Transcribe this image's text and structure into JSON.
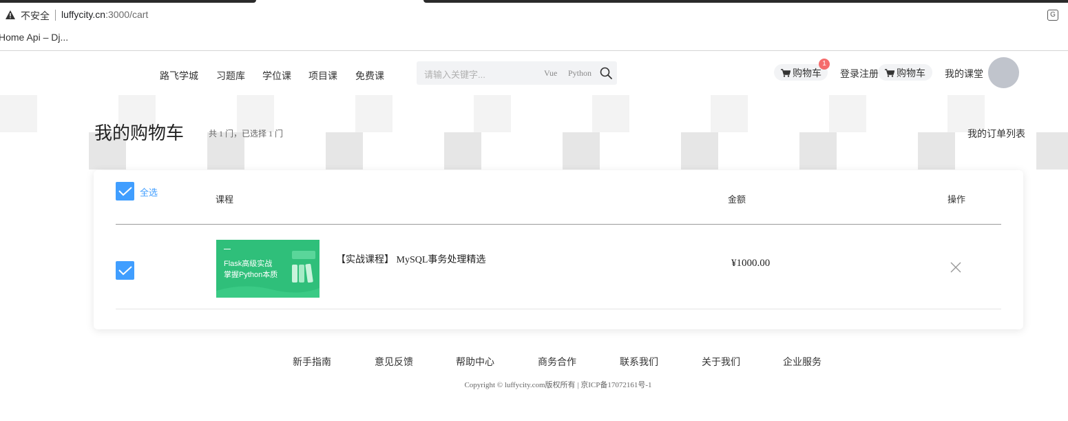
{
  "browser": {
    "security_label": "不安全",
    "url_host": "luffycity.cn",
    "url_path": ":3000/cart",
    "bookmark": "Home Api – Dj..."
  },
  "header": {
    "nav": [
      "路飞学城",
      "习题库",
      "学位课",
      "项目课",
      "免费课"
    ],
    "search": {
      "placeholder": "请输入关键字...",
      "tags": [
        "Vue",
        "Python"
      ]
    },
    "cart_label": "购物车",
    "cart_badge": "1",
    "login_label": "登录注册",
    "cart_label_2": "购物车",
    "my_class": "我的课堂"
  },
  "cart": {
    "title": "我的购物车",
    "summary": "共 1 门，已选择 1 门",
    "orders_link": "我的订单列表",
    "select_all": "全选",
    "columns": {
      "course": "课程",
      "amount": "金额",
      "action": "操作"
    },
    "items": [
      {
        "checked": true,
        "image_line1": "Flask高级实战",
        "image_line2": "掌握Python本质",
        "name": "【实战课程】 MySQL事务处理精选",
        "price": "¥1000.00"
      }
    ]
  },
  "footer": {
    "links": [
      "新手指南",
      "意见反馈",
      "帮助中心",
      "商务合作",
      "联系我们",
      "关于我们",
      "企业服务"
    ],
    "copyright": "Copyright © luffycity.com版权所有 | 京ICP备17072161号-1"
  },
  "colors": {
    "accent": "#409eff",
    "badge": "#f56c6c",
    "course_image": "#2fbf7a"
  }
}
